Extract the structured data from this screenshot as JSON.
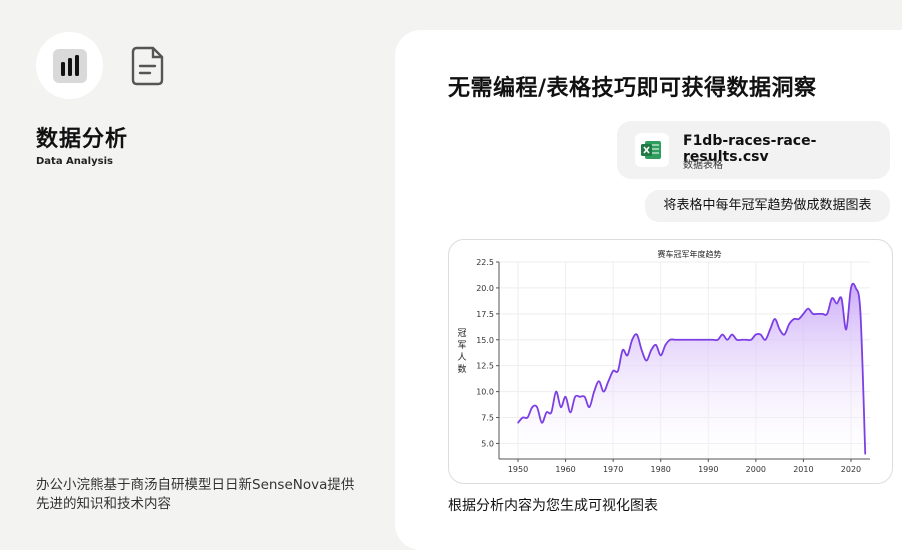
{
  "sidebar": {
    "app_icon": "bar-chart-icon",
    "doc_icon": "document-icon",
    "title": "数据分析",
    "subtitle": "Data Analysis",
    "description": "办公小浣熊基于商汤自研模型日日新SenseNova提供先进的知识和技术内容"
  },
  "main": {
    "headline": "无需编程/表格技巧即可获得数据洞察",
    "file": {
      "icon": "excel-icon",
      "name": "F1db-races-race-results.csv",
      "type": "数据表格"
    },
    "prompt": "将表格中每年冠军趋势做成数据图表",
    "response": "根据分析内容为您生成可视化图表"
  },
  "colors": {
    "accent": "#7b3fe4",
    "fill_top": "#c9a8f7",
    "excel_green": "#1f7a45"
  },
  "chart_data": {
    "type": "area",
    "title": "赛车冠军年度趋势",
    "xlabel": "",
    "ylabel": "冠军人数",
    "xlim": [
      1946,
      2024
    ],
    "ylim": [
      3.5,
      22.5
    ],
    "xticks": [
      1950,
      1960,
      1970,
      1980,
      1990,
      2000,
      2010,
      2020
    ],
    "yticks": [
      5.0,
      7.5,
      10.0,
      12.5,
      15.0,
      17.5,
      20.0,
      22.5
    ],
    "grid": true,
    "x": [
      1950,
      1951,
      1952,
      1953,
      1954,
      1955,
      1956,
      1957,
      1958,
      1959,
      1960,
      1961,
      1962,
      1963,
      1964,
      1965,
      1966,
      1967,
      1968,
      1969,
      1970,
      1971,
      1972,
      1973,
      1974,
      1975,
      1976,
      1977,
      1978,
      1979,
      1980,
      1981,
      1982,
      1983,
      1984,
      1985,
      1986,
      1987,
      1988,
      1989,
      1990,
      1991,
      1992,
      1993,
      1994,
      1995,
      1996,
      1997,
      1998,
      1999,
      2000,
      2001,
      2002,
      2003,
      2004,
      2005,
      2006,
      2007,
      2008,
      2009,
      2010,
      2011,
      2012,
      2013,
      2014,
      2015,
      2016,
      2017,
      2018,
      2019,
      2020,
      2021,
      2022,
      2023
    ],
    "values": [
      7,
      7.5,
      7.5,
      8.5,
      8.5,
      7,
      8,
      8,
      10,
      8.5,
      9.5,
      8,
      9.5,
      9.5,
      9.5,
      8.5,
      10,
      11,
      10,
      11,
      12,
      12,
      14,
      13.5,
      15,
      15.5,
      14,
      13,
      14,
      14.5,
      13.5,
      14.5,
      15,
      15,
      15,
      15,
      15,
      15,
      15,
      15,
      15,
      15,
      15,
      15.5,
      15,
      15.5,
      15,
      15,
      15,
      15,
      15.5,
      15.5,
      15,
      16,
      17,
      16,
      15.5,
      16.5,
      17,
      17,
      17.5,
      18,
      17.5,
      17.5,
      17.5,
      17.5,
      19,
      18.5,
      19,
      16,
      20,
      20,
      17.5,
      4
    ]
  }
}
